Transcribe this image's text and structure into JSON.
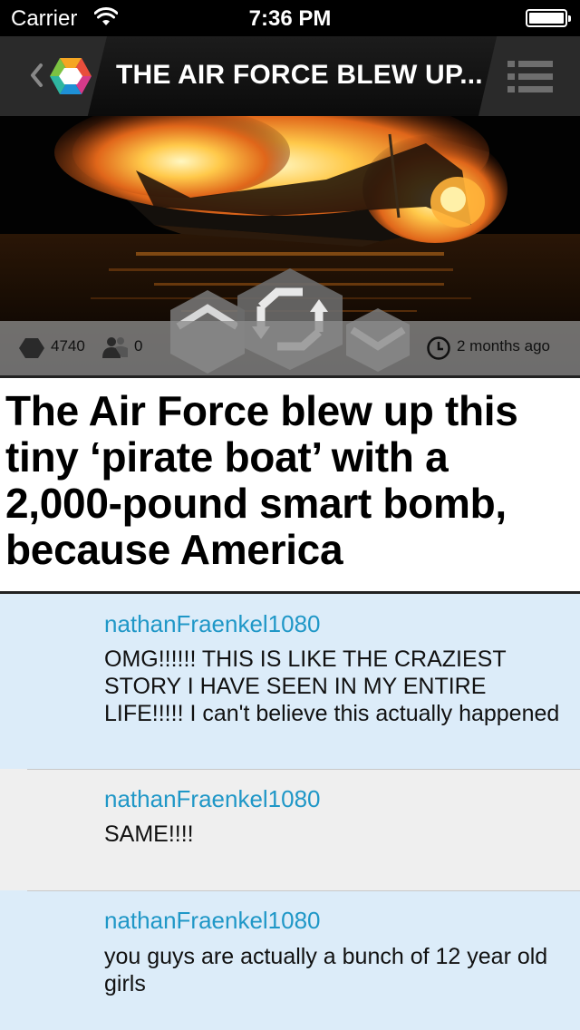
{
  "status_bar": {
    "carrier": "Carrier",
    "time": "7:36 PM",
    "wifi_icon": "wifi-icon",
    "battery_icon": "battery-icon"
  },
  "nav": {
    "title": "THE AIR FORCE BLEW UP...",
    "back_icon": "chevron-left-icon",
    "logo_icon": "hexagon-logo-icon",
    "menu_icon": "list-menu-icon"
  },
  "hero": {
    "image_description_icon": "burning-boat-image",
    "votes": "4740",
    "followers": "0",
    "time_ago": "2 months ago",
    "up_icon": "upvote-chevron-icon",
    "refresh_icon": "refresh-icon",
    "down_icon": "downvote-chevron-icon"
  },
  "article": {
    "headline": "The Air Force blew up this tiny ‘pirate boat’ with a 2,000-pound smart bomb, because America"
  },
  "comments": [
    {
      "author": "nathanFraenkel1080",
      "body": "OMG!!!!!! THIS IS LIKE THE CRAZIEST STORY I HAVE SEEN IN MY ENTIRE LIFE!!!!! I can't believe this actually happened"
    },
    {
      "author": "nathanFraenkel1080",
      "body": "SAME!!!!"
    },
    {
      "author": "nathanFraenkel1080",
      "body": "you guys are actually a bunch of 12 year old girls"
    }
  ],
  "colors": {
    "author_link": "#1f97c7",
    "comment_bg_blue": "#dcecf9",
    "comment_bg_gray": "#efefef"
  }
}
